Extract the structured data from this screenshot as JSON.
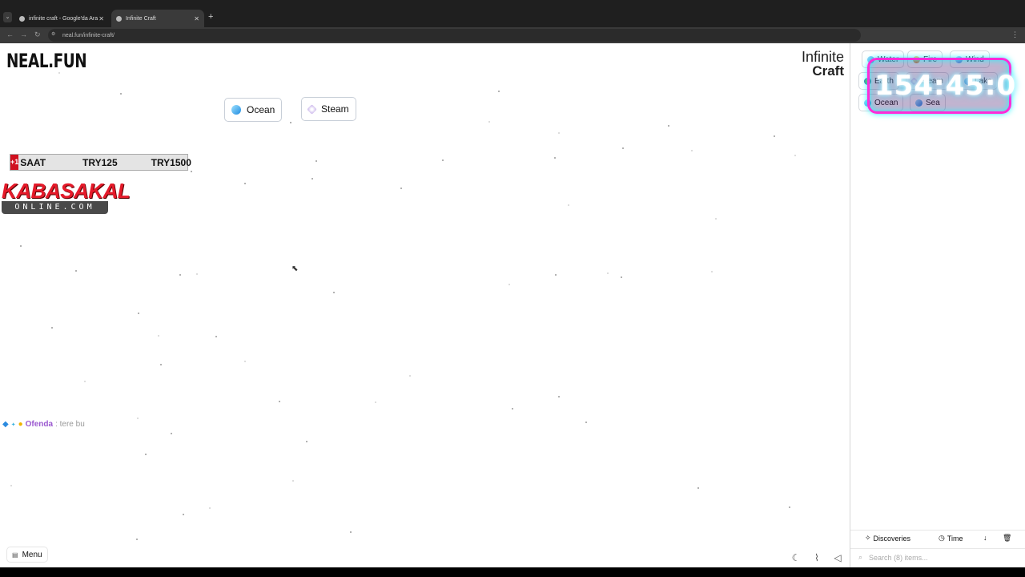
{
  "browser": {
    "tabs": [
      {
        "title": "infinite craft - Google'da Ara"
      },
      {
        "title": "Infinite Craft"
      }
    ],
    "url": "neal.fun/infinite-craft/"
  },
  "page": {
    "logo": "NEAL.FUN",
    "title_line1": "Infinite",
    "title_line2": "Craft",
    "canvas_items": [
      {
        "label": "Ocean",
        "icon": "ocean-icon"
      },
      {
        "label": "Steam",
        "icon": "steam-icon"
      }
    ],
    "menu_label": "Menu"
  },
  "sidebar": {
    "items": [
      {
        "label": "Water",
        "icon": "water-icon"
      },
      {
        "label": "Fire",
        "icon": "fire-icon"
      },
      {
        "label": "Wind",
        "icon": "wind-icon"
      },
      {
        "label": "Earth",
        "icon": "earth-icon"
      },
      {
        "label": "Steam",
        "icon": "steam-icon"
      },
      {
        "label": "Lake",
        "icon": "lake-icon"
      },
      {
        "label": "Ocean",
        "icon": "ocean-icon"
      },
      {
        "label": "Sea",
        "icon": "sea-icon"
      }
    ],
    "sort": {
      "discoveries": "Discoveries",
      "time": "Time"
    },
    "search_placeholder": "Search (8) items..."
  },
  "overlay": {
    "promo": {
      "badge": "+1",
      "col1": "SAAT",
      "col2": "TRY125",
      "col3": "TRY1500"
    },
    "brand_top": "KABASAKAL",
    "brand_bottom": "ONLINE.COM",
    "chat": {
      "user": "Ofenda",
      "message": ": tere bu"
    },
    "timer": "154:45:0"
  }
}
